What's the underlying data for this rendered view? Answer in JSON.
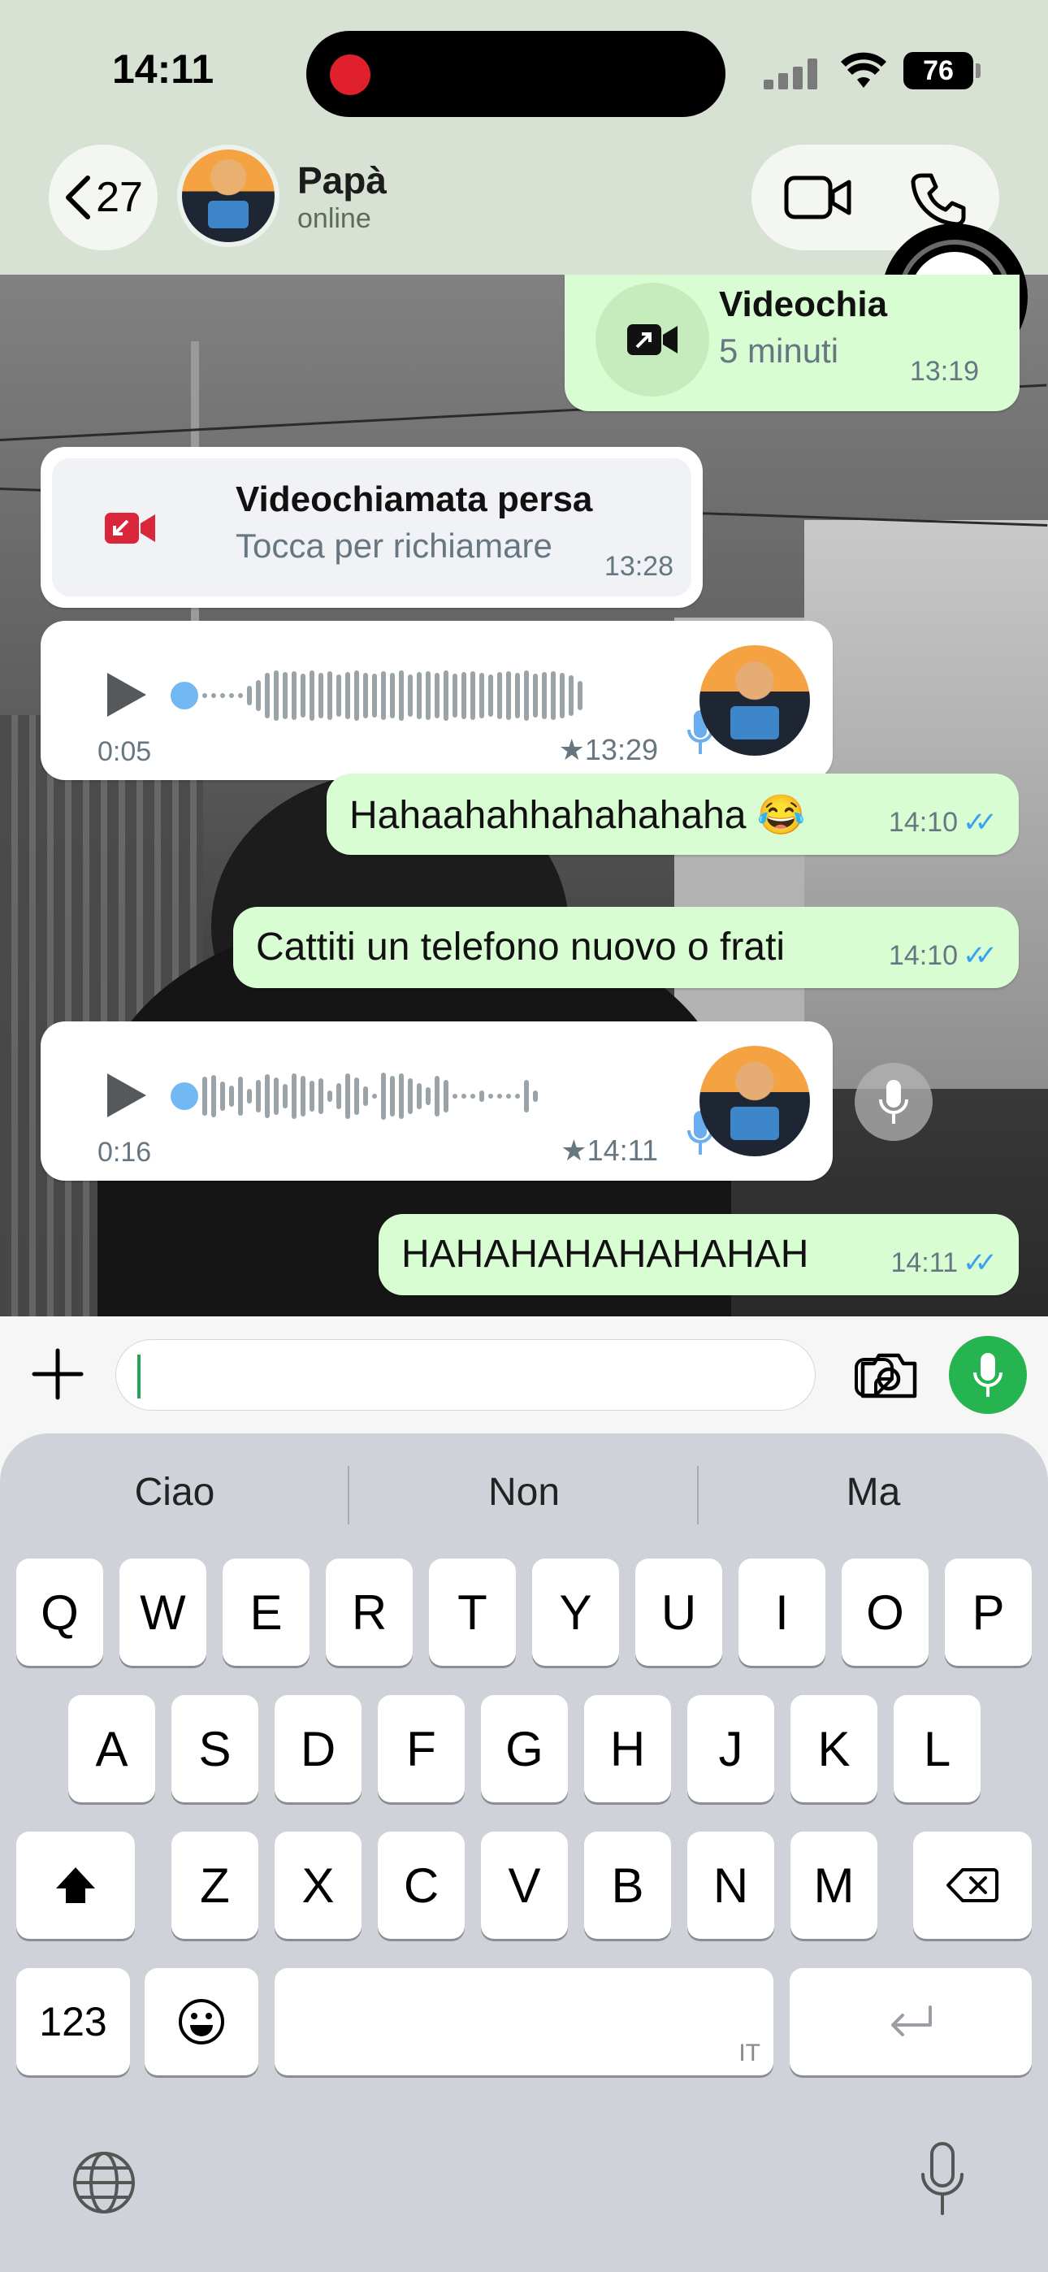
{
  "status_bar": {
    "time": "14:11",
    "battery": "76"
  },
  "header": {
    "back_count": "27",
    "contact_name": "Papà",
    "contact_status": "online",
    "video_icon": "video-camera-icon",
    "call_icon": "phone-icon"
  },
  "messages": {
    "video_out": {
      "title": "Videochia",
      "subtitle": "5 minuti",
      "time": "13:19"
    },
    "missed_call": {
      "title": "Videochiamata persa",
      "subtitle": "Tocca per richiamare",
      "time": "13:28"
    },
    "voice1": {
      "duration": "0:05",
      "time": "13:29"
    },
    "text1": {
      "text": "Hahaahahhahahahaha 😂",
      "time": "14:10"
    },
    "text2": {
      "text": "Cattiti un telefono nuovo o frati",
      "time": "14:10"
    },
    "voice2": {
      "duration": "0:16",
      "time": "14:11"
    },
    "text3": {
      "text": "HAHAHAHAHAHAHAH",
      "time": "14:11"
    },
    "star": "★"
  },
  "keyboard": {
    "suggestions": [
      "Ciao",
      "Non",
      "Ma"
    ],
    "row1": [
      "Q",
      "W",
      "E",
      "R",
      "T",
      "Y",
      "U",
      "I",
      "O",
      "P"
    ],
    "row2": [
      "A",
      "S",
      "D",
      "F",
      "G",
      "H",
      "J",
      "K",
      "L"
    ],
    "row3": [
      "Z",
      "X",
      "C",
      "V",
      "B",
      "N",
      "M"
    ],
    "numbers_label": "123",
    "space_language": "IT"
  },
  "colors": {
    "header_bg": "#d8e2d4",
    "outgoing_bubble": "#d9fdd3",
    "incoming_bubble": "#ffffff",
    "read_ticks": "#3aa0f0",
    "accent_green": "#25b44f",
    "missed_red": "#d9263b"
  }
}
